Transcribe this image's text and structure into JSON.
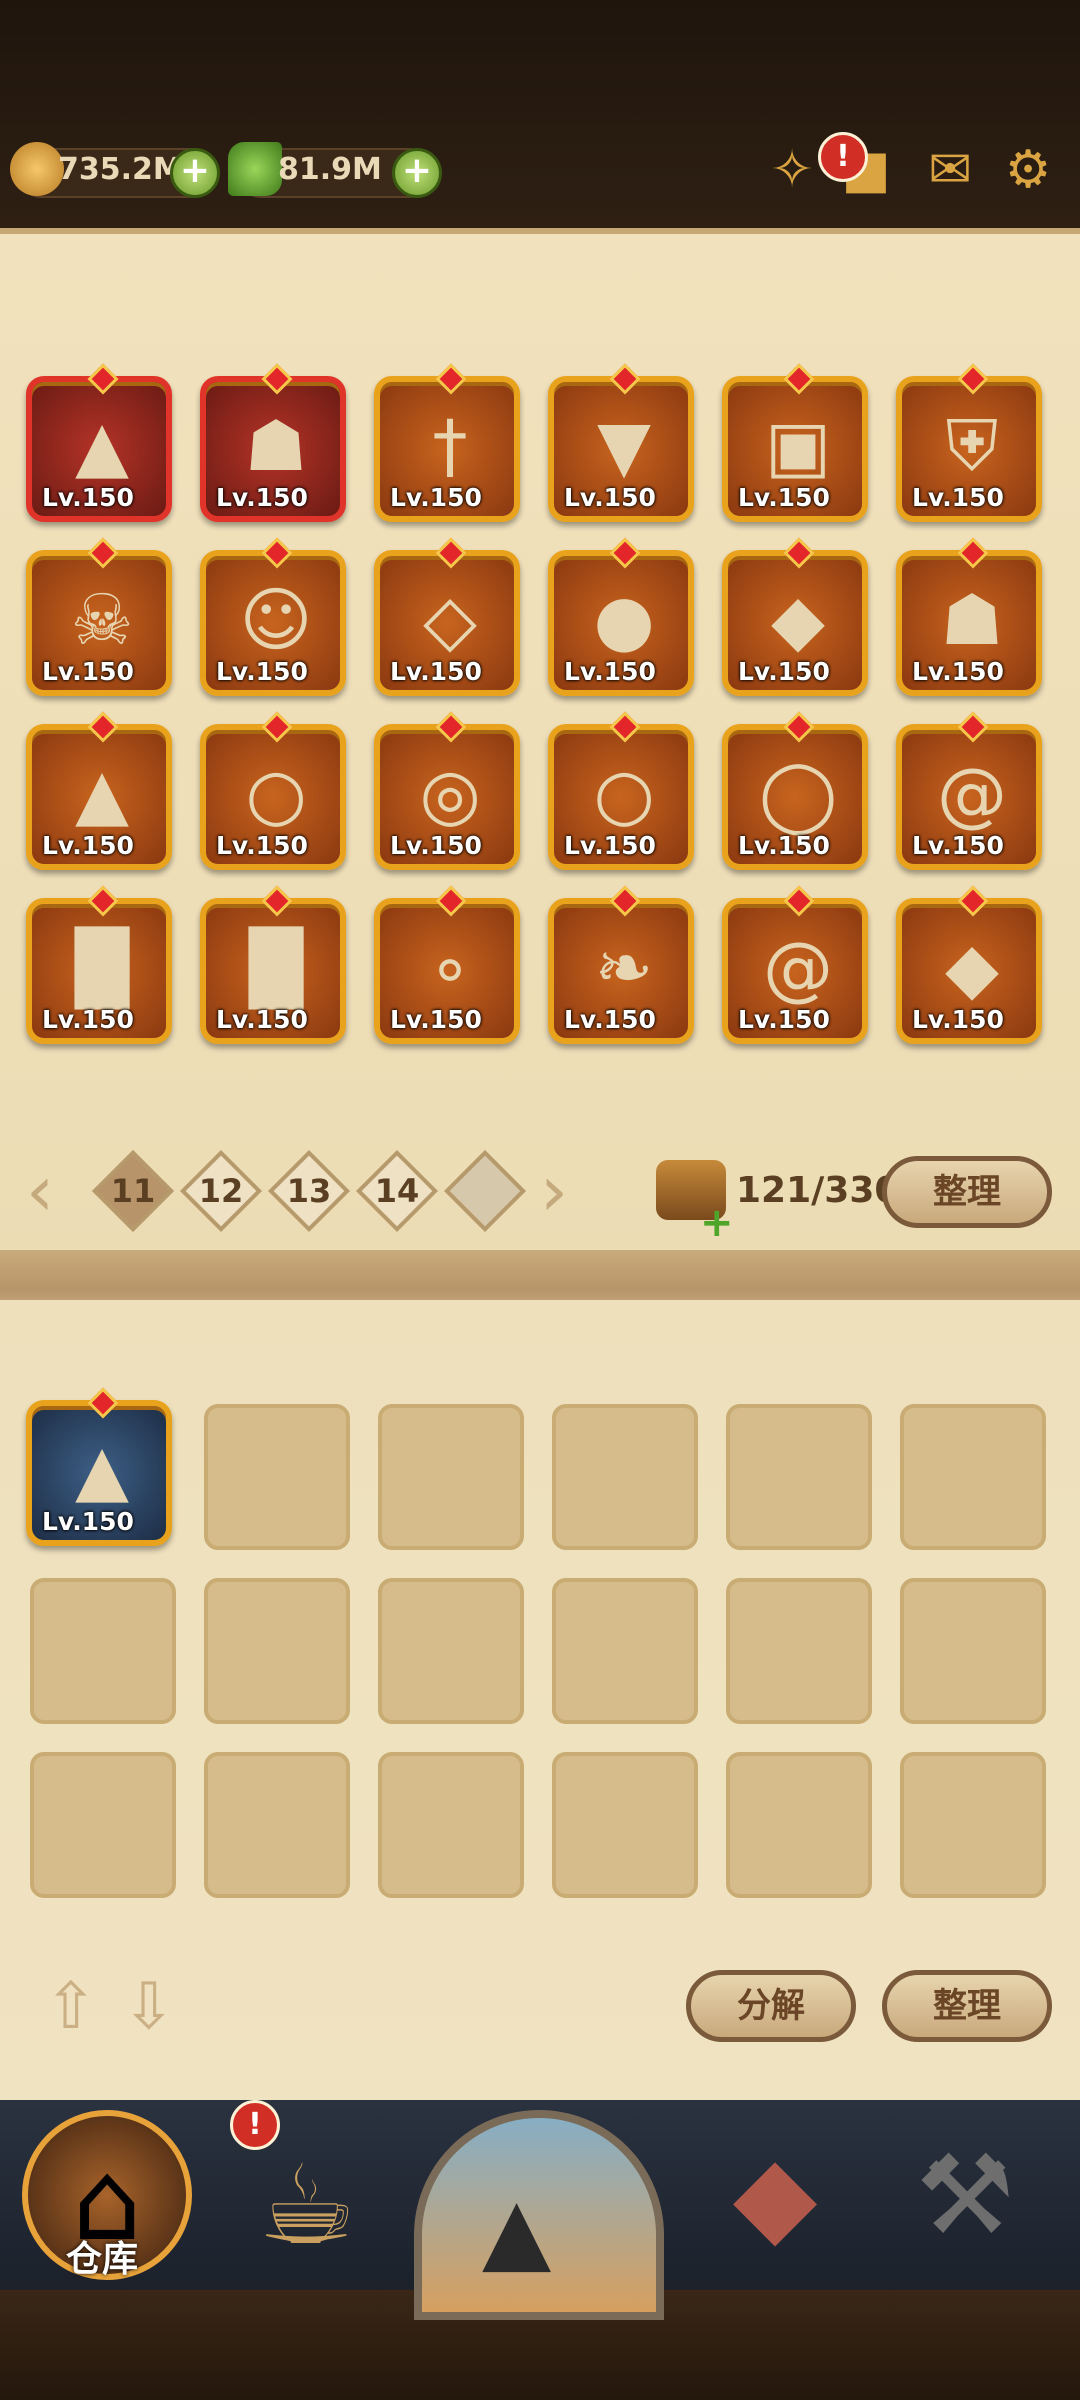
{
  "resources": {
    "gold": {
      "icon": "gold-coin-icon",
      "value": "735.2M"
    },
    "gems": {
      "icon": "green-gem-icon",
      "value": "81.9M"
    }
  },
  "top_icons": [
    "horn-icon",
    "chat-icon",
    "mail-icon",
    "settings-gear-icon"
  ],
  "alert_badge": "!",
  "equipped_grid": {
    "items": [
      {
        "icon": "wizard-hat-icon",
        "level": "Lv.150",
        "frame": "red"
      },
      {
        "icon": "armor-helmet-icon",
        "level": "Lv.150",
        "frame": "red"
      },
      {
        "icon": "dagger-icon",
        "level": "Lv.150",
        "frame": "orange"
      },
      {
        "icon": "carrot-icon",
        "level": "Lv.150",
        "frame": "orange"
      },
      {
        "icon": "bucket-icon",
        "level": "Lv.150",
        "frame": "orange"
      },
      {
        "icon": "wolf-shield-icon",
        "level": "Lv.150",
        "frame": "orange"
      },
      {
        "icon": "skull-helmet-icon",
        "level": "Lv.150",
        "frame": "orange"
      },
      {
        "icon": "mask-icon",
        "level": "Lv.150",
        "frame": "orange"
      },
      {
        "icon": "crystal-necklace-icon",
        "level": "Lv.150",
        "frame": "orange"
      },
      {
        "icon": "green-amulet-icon",
        "level": "Lv.150",
        "frame": "orange"
      },
      {
        "icon": "ruby-necklace-icon",
        "level": "Lv.150",
        "frame": "orange"
      },
      {
        "icon": "dark-armor-icon",
        "level": "Lv.150",
        "frame": "orange"
      },
      {
        "icon": "brown-cloak-icon",
        "level": "Lv.150",
        "frame": "orange"
      },
      {
        "icon": "purple-ring-icon",
        "level": "Lv.150",
        "frame": "orange"
      },
      {
        "icon": "emerald-ring-icon",
        "level": "Lv.150",
        "frame": "orange"
      },
      {
        "icon": "ruby-ring-icon",
        "level": "Lv.150",
        "frame": "orange"
      },
      {
        "icon": "gold-ring-icon",
        "level": "Lv.150",
        "frame": "orange"
      },
      {
        "icon": "spiral-ring-icon",
        "level": "Lv.150",
        "frame": "orange"
      },
      {
        "icon": "iron-boots-icon",
        "level": "Lv.150",
        "frame": "orange"
      },
      {
        "icon": "steel-boots-icon",
        "level": "Lv.150",
        "frame": "orange"
      },
      {
        "icon": "pearl-necklace-icon",
        "level": "Lv.150",
        "frame": "orange"
      },
      {
        "icon": "scroll-staff-icon",
        "level": "Lv.150",
        "frame": "orange"
      },
      {
        "icon": "shell-necklace-icon",
        "level": "Lv.150",
        "frame": "orange"
      },
      {
        "icon": "amethyst-necklace-icon",
        "level": "Lv.150",
        "frame": "orange"
      }
    ]
  },
  "pagination": {
    "pages": [
      "11",
      "12",
      "13",
      "14"
    ],
    "active": "11",
    "locked_icon": "lock-icon"
  },
  "capacity": {
    "icon": "chest-plus-icon",
    "text": "121/330"
  },
  "sort_button": "整理",
  "backpack": {
    "items": [
      {
        "icon": "dark-hood-cloak-icon",
        "level": "Lv.150",
        "frame": "blue"
      }
    ],
    "empty_slots": 17
  },
  "bottom_buttons": {
    "decompose": "分解",
    "sort": "整理"
  },
  "nav": {
    "items": [
      {
        "icon": "warehouse-icon",
        "label": "仓库",
        "active": true
      },
      {
        "icon": "tavern-mug-icon",
        "label": "",
        "alert": "!"
      },
      {
        "icon": "adventure-portal-icon",
        "label": ""
      },
      {
        "icon": "treasure-chest-icon",
        "label": ""
      },
      {
        "icon": "forge-icon",
        "label": ""
      }
    ]
  }
}
